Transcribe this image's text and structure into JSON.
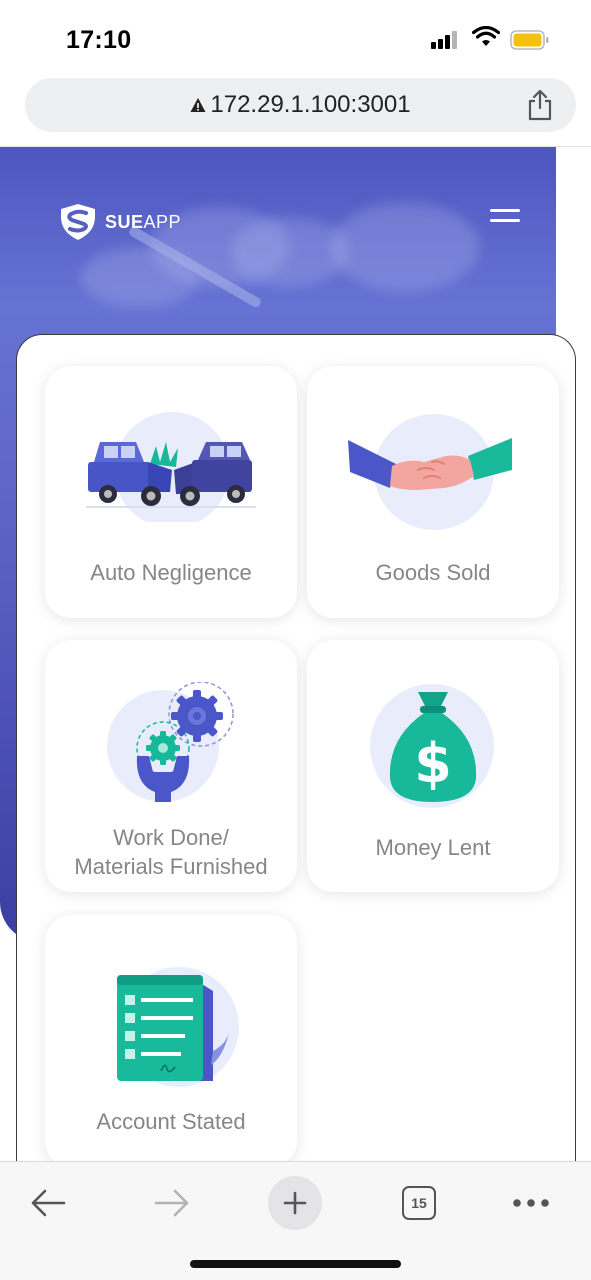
{
  "status_bar": {
    "time": "17:10"
  },
  "browser": {
    "url": "172.29.1.100:3001",
    "open_tabs": "15"
  },
  "header": {
    "brand_bold": "SUE",
    "brand_light": "APP"
  },
  "cards": [
    {
      "label": "Auto Negligence",
      "icon": "car-crash-icon"
    },
    {
      "label": "Goods Sold",
      "icon": "handshake-icon"
    },
    {
      "label_line1": "Work Done/",
      "label_line2": "Materials Furnished",
      "icon": "gears-wrench-icon"
    },
    {
      "label": "Money Lent",
      "icon": "money-bag-icon"
    },
    {
      "label": "Account Stated",
      "icon": "document-scroll-icon"
    }
  ],
  "colors": {
    "accent": "#4e57c3",
    "teal": "#16b89a",
    "card_label": "#868686"
  }
}
